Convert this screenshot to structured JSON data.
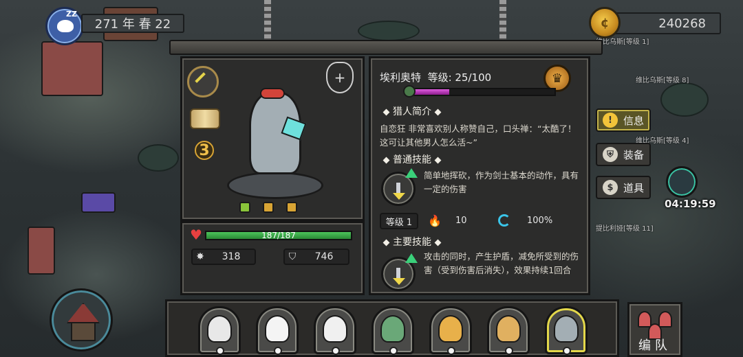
{
  "header": {
    "date": "271 年 春 22",
    "sleep_label": "ZZ",
    "coins": "240268"
  },
  "hero": {
    "name": "埃利奥特",
    "level_text": "等级: 25/100",
    "level_progress": 0.25,
    "star_level": "3",
    "hp_text": "187/187",
    "hp_fraction": 1.0,
    "attack": "318",
    "defense": "746"
  },
  "bio": {
    "title": "猎人简介",
    "text": "自恋狂 非常喜欢别人称赞自己，口头禅：“太酷了！这可让其他男人怎么活~”"
  },
  "normal_skill": {
    "title": "普通技能",
    "text": "简单地挥砍，作为剑士基本的动作，具有一定的伤害",
    "level": "等级 1",
    "fire_value": "10",
    "crit_value": "100%"
  },
  "main_skill": {
    "title": "主要技能",
    "text": "攻击的同时，产生护盾，减免所受到的伤害（受到伤害后消失），效果持续1回合"
  },
  "side_tabs": [
    {
      "label": "信息",
      "icon": "info-icon",
      "active": true
    },
    {
      "label": "装备",
      "icon": "equipment-icon",
      "active": false
    },
    {
      "label": "道具",
      "icon": "item-bag-icon",
      "active": false
    }
  ],
  "timer": "04:19:59",
  "map_labels": {
    "villager_1": "维比乌斯[等级 1]",
    "villager_8": "维比乌斯[等级 8]",
    "villager_4": "维比乌斯[等级 4]",
    "villager_11": "提比利娅[等级 11]"
  },
  "team_button_label": "编队",
  "roster": [
    {
      "name": "eagle",
      "color": "#e8e8e8"
    },
    {
      "name": "polar-bear",
      "color": "#f4f4f4"
    },
    {
      "name": "white-hair",
      "color": "#f0f0f0"
    },
    {
      "name": "crocodile",
      "color": "#6aa878"
    },
    {
      "name": "leopard",
      "color": "#e8b04a"
    },
    {
      "name": "giraffe",
      "color": "#e0b060"
    },
    {
      "name": "elephant",
      "color": "#a3aeb4",
      "selected": true
    }
  ],
  "colors": {
    "hp": "#3ab04a",
    "xp": "#c040c0",
    "accent_gold": "#e4c44a"
  }
}
